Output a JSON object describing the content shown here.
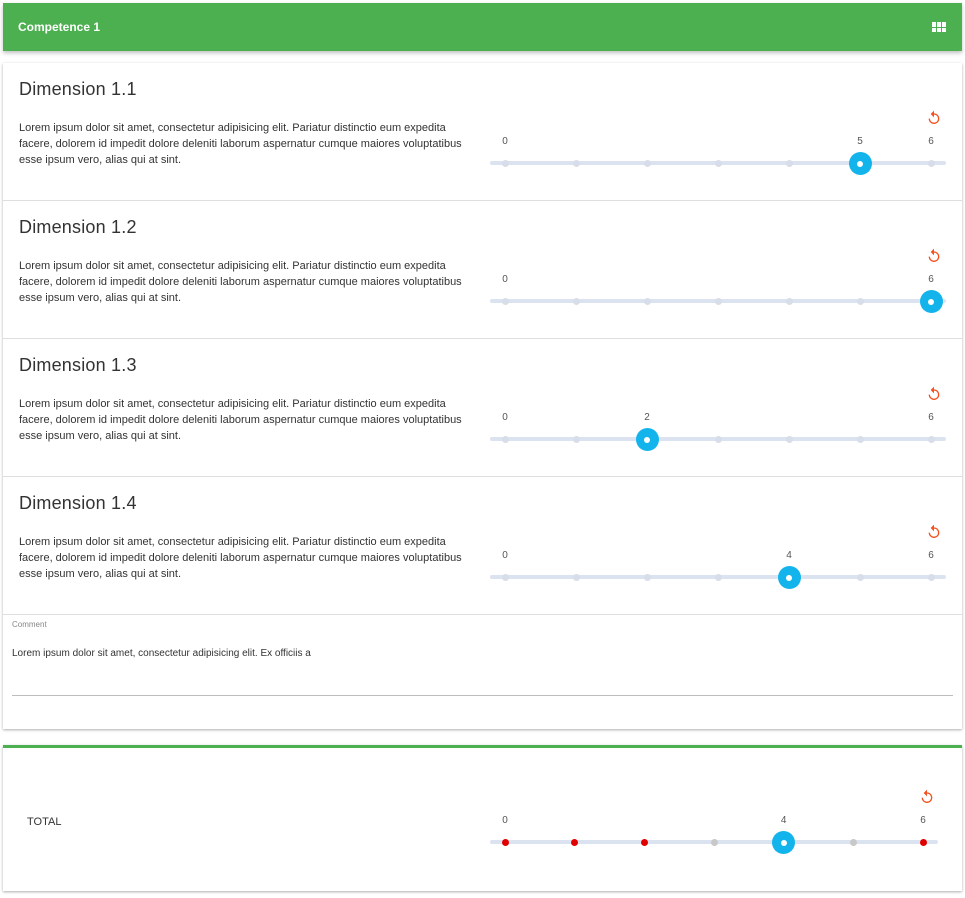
{
  "header": {
    "title": "Competence 1",
    "view_icon": "grid-view-icon"
  },
  "dimensions": [
    {
      "title": "Dimension 1.1",
      "description": "Lorem ipsum dolor sit amet, consectetur adipisicing elit. Pariatur distinctio eum expedita facere, dolorem id impedit dolore deleniti laborum aspernatur cumque maiores voluptatibus esse ipsum vero, alias qui at sint.",
      "min": "0",
      "max": "6",
      "value": "5"
    },
    {
      "title": "Dimension 1.2",
      "description": "Lorem ipsum dolor sit amet, consectetur adipisicing elit. Pariatur distinctio eum expedita facere, dolorem id impedit dolore deleniti laborum aspernatur cumque maiores voluptatibus esse ipsum vero, alias qui at sint.",
      "min": "0",
      "max": "6",
      "value": "6"
    },
    {
      "title": "Dimension 1.3",
      "description": "Lorem ipsum dolor sit amet, consectetur adipisicing elit. Pariatur distinctio eum expedita facere, dolorem id impedit dolore deleniti laborum aspernatur cumque maiores voluptatibus esse ipsum vero, alias qui at sint.",
      "min": "0",
      "max": "6",
      "value": "2"
    },
    {
      "title": "Dimension 1.4",
      "description": "Lorem ipsum dolor sit amet, consectetur adipisicing elit. Pariatur distinctio eum expedita facere, dolorem id impedit dolore deleniti laborum aspernatur cumque maiores voluptatibus esse ipsum vero, alias qui at sint.",
      "min": "0",
      "max": "6",
      "value": "4"
    }
  ],
  "comment": {
    "label": "Comment",
    "value": "Lorem ipsum dolor sit amet, consectetur adipisicing elit. Ex officiis a"
  },
  "total": {
    "label": "TOTAL",
    "min": "0",
    "max": "6",
    "value": "4",
    "tick_states": [
      "red",
      "red",
      "red",
      "grey",
      "thumb",
      "grey",
      "red"
    ]
  },
  "colors": {
    "header_bg": "#4caf50",
    "slider_thumb": "#13b4ec",
    "reset_icon": "#f4511e",
    "tick_red": "#e00000",
    "track": "#dbe2f0"
  },
  "icons": {
    "reset": "reset-icon"
  }
}
